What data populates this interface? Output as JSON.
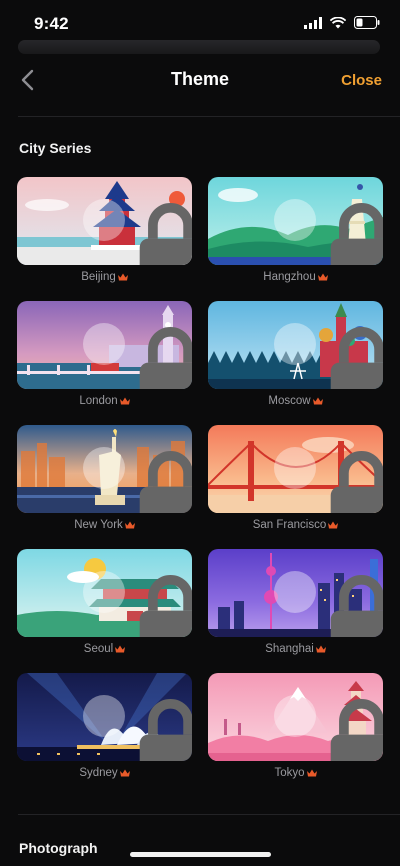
{
  "status_bar": {
    "time": "9:42"
  },
  "nav": {
    "title": "Theme",
    "close_label": "Close"
  },
  "sections": {
    "city_series": "City Series",
    "photograph": "Photograph"
  },
  "accent_color": "#f0a032",
  "crown_color": "#e85a2a",
  "cities": [
    {
      "name": "Beijing",
      "icon": "temple-of-heaven",
      "locked": true
    },
    {
      "name": "Hangzhou",
      "icon": "pagoda-lake",
      "locked": true
    },
    {
      "name": "London",
      "icon": "big-ben",
      "locked": true
    },
    {
      "name": "Moscow",
      "icon": "st-basils-cathedral",
      "locked": true
    },
    {
      "name": "New York",
      "icon": "statue-of-liberty",
      "locked": true
    },
    {
      "name": "San Francisco",
      "icon": "golden-gate-bridge",
      "locked": true
    },
    {
      "name": "Seoul",
      "icon": "palace-gate",
      "locked": true
    },
    {
      "name": "Shanghai",
      "icon": "pearl-tower",
      "locked": true
    },
    {
      "name": "Sydney",
      "icon": "opera-house",
      "locked": true
    },
    {
      "name": "Tokyo",
      "icon": "mount-fuji-pagoda",
      "locked": true
    }
  ]
}
